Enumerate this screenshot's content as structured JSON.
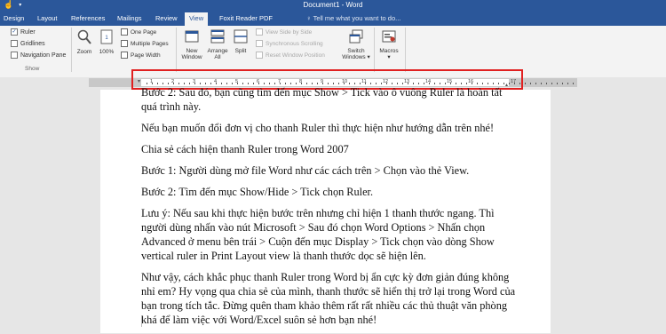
{
  "window": {
    "title": "Document1 - Word",
    "qat_icons": [
      "touch-mode-icon",
      "dropdown-icon"
    ]
  },
  "tabs": [
    {
      "label": "Design"
    },
    {
      "label": "Layout"
    },
    {
      "label": "References"
    },
    {
      "label": "Mailings"
    },
    {
      "label": "Review"
    },
    {
      "label": "View",
      "active": true
    },
    {
      "label": "Foxit Reader PDF"
    }
  ],
  "tell_me": {
    "placeholder": "Tell me what you want to do..."
  },
  "ribbon": {
    "show": {
      "ruler": "Ruler",
      "gridlines": "Gridlines",
      "navigation_pane": "Navigation Pane",
      "ruler_checked": true,
      "group_label": "Show"
    },
    "zoom": {
      "zoom": "Zoom",
      "percent": "100%",
      "one_page": "One Page",
      "multiple_pages": "Multiple Pages",
      "page_width": "Page Width"
    },
    "window": {
      "new_window": [
        "New",
        "Window"
      ],
      "arrange_all": [
        "Arrange",
        "All"
      ],
      "split": "Split",
      "view_side_by_side": "View Side by Side",
      "synchronous_scrolling": "Synchronous Scrolling",
      "reset_window_position": "Reset Window Position",
      "switch_windows": [
        "Switch",
        "Windows ▾"
      ]
    },
    "macros": {
      "label": "Macros",
      "arrow": "▾"
    }
  },
  "ruler_numbers": [
    "1",
    "2",
    "3",
    "4",
    "5",
    "6",
    "7",
    "8",
    "9",
    "10",
    "11",
    "12",
    "13",
    "14",
    "15",
    "16",
    "17"
  ],
  "document": {
    "paragraphs": [
      "Bước 2: Sau đó, bạn cũng tìm đến mục Show > Tick vào ô vuông Ruler là hoàn tất quá trình này.",
      "Nếu bạn muốn đổi đơn vị cho thanh Ruler thì thực hiện như hướng dẫn trên nhé!",
      "Chia sẻ cách hiện thanh Ruler trong Word 2007",
      "Bước 1: Người dùng mở file Word như các cách trên > Chọn vào thẻ View.",
      "Bước 2: Tìm đến mục Show/Hide > Tick chọn Ruler.",
      "Lưu ý: Nếu sau khi thực hiện bước trên nhưng chỉ hiện 1 thanh thước ngang. Thì người dùng nhấn vào nút Microsoft > Sau đó chọn Word Options > Nhấn chọn Advanced ở menu bên trái > Cuộn đến mục Display > Tick chọn vào dòng Show vertical ruler in Print Layout view là thanh thước dọc sẽ hiện lên.",
      "Như vậy, cách khắc phục thanh Ruler trong Word bị ẩn cực kỳ đơn giản đúng không nhỉ em? Hy vọng qua chia sẻ của mình, thanh thước sẽ hiển thị trở lại trong Word của bạn trong tích tắc. Đừng quên tham khảo thêm rất rất nhiều các thủ thuật văn phòng khá để làm việc với Word/Excel suôn sẻ hơn bạn nhé!"
    ]
  },
  "colors": {
    "word_blue": "#2b579a",
    "highlight": "#e02020"
  }
}
